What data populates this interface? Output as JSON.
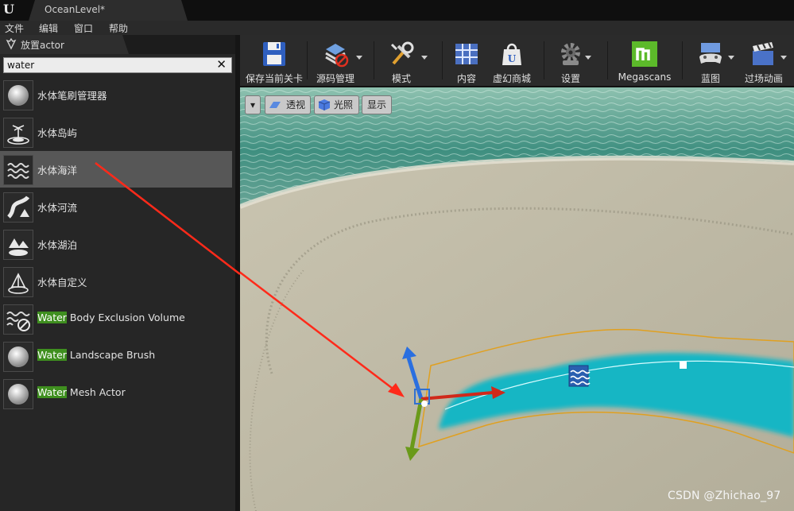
{
  "window": {
    "doc_tab": "OceanLevel*"
  },
  "menu": [
    "文件",
    "编辑",
    "窗口",
    "帮助"
  ],
  "place_actor_panel": {
    "tab_label": "放置actor",
    "search": {
      "value": "water"
    },
    "items": [
      {
        "label": "水体笔刷管理器",
        "icon": "sphere-icon"
      },
      {
        "label": "水体岛屿",
        "icon": "island-icon"
      },
      {
        "label": "水体海洋",
        "icon": "ocean-waves-icon",
        "selected": true
      },
      {
        "label": "水体河流",
        "icon": "river-icon"
      },
      {
        "label": "水体湖泊",
        "icon": "lake-icon"
      },
      {
        "label": "水体自定义",
        "icon": "custom-water-icon"
      },
      {
        "highlight": "Water",
        "rest": " Body Exclusion Volume",
        "icon": "exclusion-volume-icon"
      },
      {
        "highlight": "Water",
        "rest": " Landscape Brush",
        "icon": "sphere-icon"
      },
      {
        "highlight": "Water",
        "rest": " Mesh Actor",
        "icon": "sphere-icon"
      }
    ]
  },
  "toolbar": {
    "buttons": [
      {
        "label": "保存当前关卡",
        "icon": "save-icon",
        "caret": false
      },
      {
        "label": "源码管理",
        "icon": "source-control-icon",
        "caret": true
      },
      {
        "label": "模式",
        "icon": "modes-tools-icon",
        "caret": true
      },
      {
        "label": "内容",
        "icon": "content-grid-icon",
        "caret": false
      },
      {
        "label": "虚幻商城",
        "icon": "marketplace-bag-icon",
        "caret": false
      },
      {
        "label": "设置",
        "icon": "settings-gear-icon",
        "caret": true
      },
      {
        "label": "Megascans",
        "icon": "megascans-logo-icon",
        "caret": false
      },
      {
        "label": "蓝图",
        "icon": "blueprint-gamepad-icon",
        "caret": true
      },
      {
        "label": "过场动画",
        "icon": "clapperboard-icon",
        "caret": true
      }
    ]
  },
  "viewport": {
    "buttons": {
      "perspective": "透视",
      "lighting": "光照",
      "show": "显示"
    }
  },
  "watermark": "CSDN @Zhichao_97",
  "colors": {
    "selection_highlight": "#3f8f1f",
    "arrow": "#ff2a1a",
    "water": "#19b6c4",
    "spline_outline": "#e0a020"
  }
}
